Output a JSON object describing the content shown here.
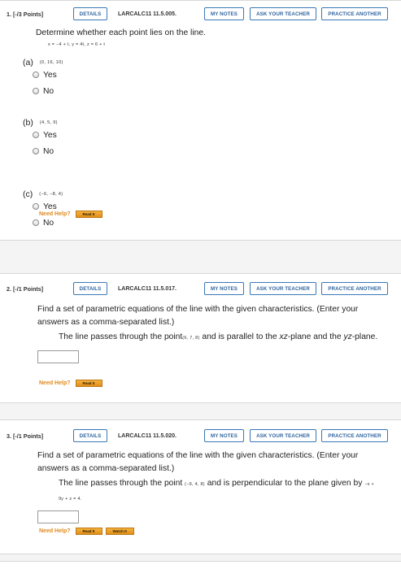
{
  "q1": {
    "number": "1.",
    "points": "[-/3 Points]",
    "details": "DETAILS",
    "ref": "LARCALC11 11.5.005.",
    "my_notes": "MY NOTES",
    "ask_teacher": "ASK YOUR TEACHER",
    "practice": "PRACTICE ANOTHER",
    "prompt": "Determine whether each point lies on the line.",
    "equation": "x = −4 + t,  y = 4t,  z = 6 + t",
    "parts": [
      {
        "label": "(a)",
        "point": "(0, 16, 10)",
        "options": [
          "Yes",
          "No"
        ]
      },
      {
        "label": "(b)",
        "point": "(4, 5, 9)",
        "options": [
          "Yes",
          "No"
        ]
      },
      {
        "label": "(c)",
        "point": "(−6, −8, 4)",
        "options": [
          "Yes",
          "No"
        ]
      }
    ],
    "need_help": "Need Help?",
    "help_buttons": [
      "Read It"
    ]
  },
  "q2": {
    "number": "2.",
    "points": "[-/1 Points]",
    "details": "DETAILS",
    "ref": "LARCALC11 11.5.017.",
    "my_notes": "MY NOTES",
    "ask_teacher": "ASK YOUR TEACHER",
    "practice": "PRACTICE ANOTHER",
    "prompt": "Find a set of parametric equations of the line with the given characteristics. (Enter your answers as a comma-separated list.)",
    "line_a": "The line passes through the point",
    "point": "(6, 7, 8)",
    "line_b": " and is parallel to the ",
    "plane1": "xz",
    "line_c": "-plane and the ",
    "plane2": "yz",
    "line_d": "-plane.",
    "need_help": "Need Help?",
    "help_buttons": [
      "Read It"
    ]
  },
  "q3": {
    "number": "3.",
    "points": "[-/1 Points]",
    "details": "DETAILS",
    "ref": "LARCALC11 11.5.020.",
    "my_notes": "MY NOTES",
    "ask_teacher": "ASK YOUR TEACHER",
    "practice": "PRACTICE ANOTHER",
    "prompt": "Find a set of parametric equations of the line with the given characteristics. (Enter your answers as a comma-separated list.)",
    "line_a": "The line passes through the point ",
    "point": "(−9, 4, 8)",
    "line_b": " and is perpendicular to the plane given by ",
    "plane_eq": "−x + 9y + z = 4.",
    "need_help": "Need Help?",
    "help_buttons": [
      "Read It",
      "Watch It"
    ]
  }
}
